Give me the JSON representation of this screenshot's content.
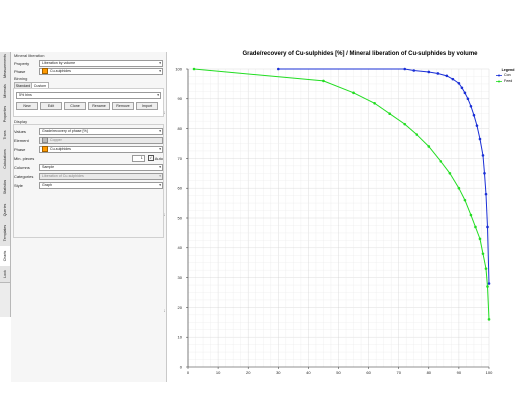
{
  "side_tabs": [
    "Measurements",
    "Minerals",
    "Properties",
    "Trans",
    "Calculations",
    "Statistics",
    "Queries",
    "Templates",
    "Charts",
    "Lock"
  ],
  "section_title": "Mineral liberation",
  "property": {
    "label": "Property",
    "value": "Liberation by volume"
  },
  "phase": {
    "label": "Phase",
    "value": "Cu-sulphides"
  },
  "binning": {
    "label": "Binning",
    "tabs": [
      "Standard",
      "Custom"
    ],
    "active_tab": "Custom",
    "value": "5% bins"
  },
  "buttons": [
    "New",
    "Edit",
    "Clone",
    "Rename",
    "Remove",
    "Import"
  ],
  "display": {
    "title": "Display",
    "values_label": "Values",
    "values_value": "Grade/recovery of phase [%]",
    "element_label": "Element",
    "element_value": "Copper",
    "phase_label": "Phase",
    "phase_value": "Cu-sulphides",
    "min_label": "Min. pieces",
    "min_value": "1",
    "auto_label": "Auto",
    "columns_label": "Columns",
    "columns_value": "Sample",
    "categories_label": "Categories",
    "categories_value": "Liberation of Cu-sulphides",
    "style_label": "Style",
    "style_value": "Graph"
  },
  "chart_data": {
    "type": "line",
    "title": "Grade/recovery of Cu-sulphides [%] / Mineral liberation of Cu-sulphides by volume",
    "xlim": [
      0,
      100
    ],
    "ylim": [
      0,
      100
    ],
    "xticks": [
      "0",
      "10",
      "20",
      "30",
      "40",
      "50",
      "60",
      "70",
      "80",
      "90",
      "100"
    ],
    "yticks": [
      "0",
      "10",
      "20",
      "30",
      "40",
      "50",
      "60",
      "70",
      "80",
      "90",
      "100"
    ],
    "legend_title": "Legend",
    "legend_position": "right",
    "grid": true,
    "series": [
      {
        "name": "Con",
        "color": "#1a2fd6",
        "x": [
          30,
          72,
          75,
          80,
          83,
          86,
          88,
          90,
          91,
          92,
          93,
          94,
          95,
          96,
          97,
          98,
          98.5,
          99,
          99.5,
          100
        ],
        "y": [
          100,
          100,
          99.5,
          99,
          98.5,
          97.7,
          96.6,
          95.2,
          93.7,
          92,
          90,
          87.5,
          84.5,
          81,
          76.5,
          71,
          65,
          58,
          47,
          28
        ]
      },
      {
        "name": "Feed",
        "color": "#22dd22",
        "x": [
          2,
          45,
          55,
          62,
          67,
          72,
          76,
          80,
          84,
          87,
          90,
          92,
          94,
          95.5,
          97,
          98,
          99,
          99.5,
          100
        ],
        "y": [
          100,
          96,
          92,
          88.5,
          85,
          81.5,
          78,
          74,
          69,
          65,
          60,
          56,
          51,
          47,
          43,
          38,
          33,
          27,
          16
        ]
      }
    ]
  }
}
